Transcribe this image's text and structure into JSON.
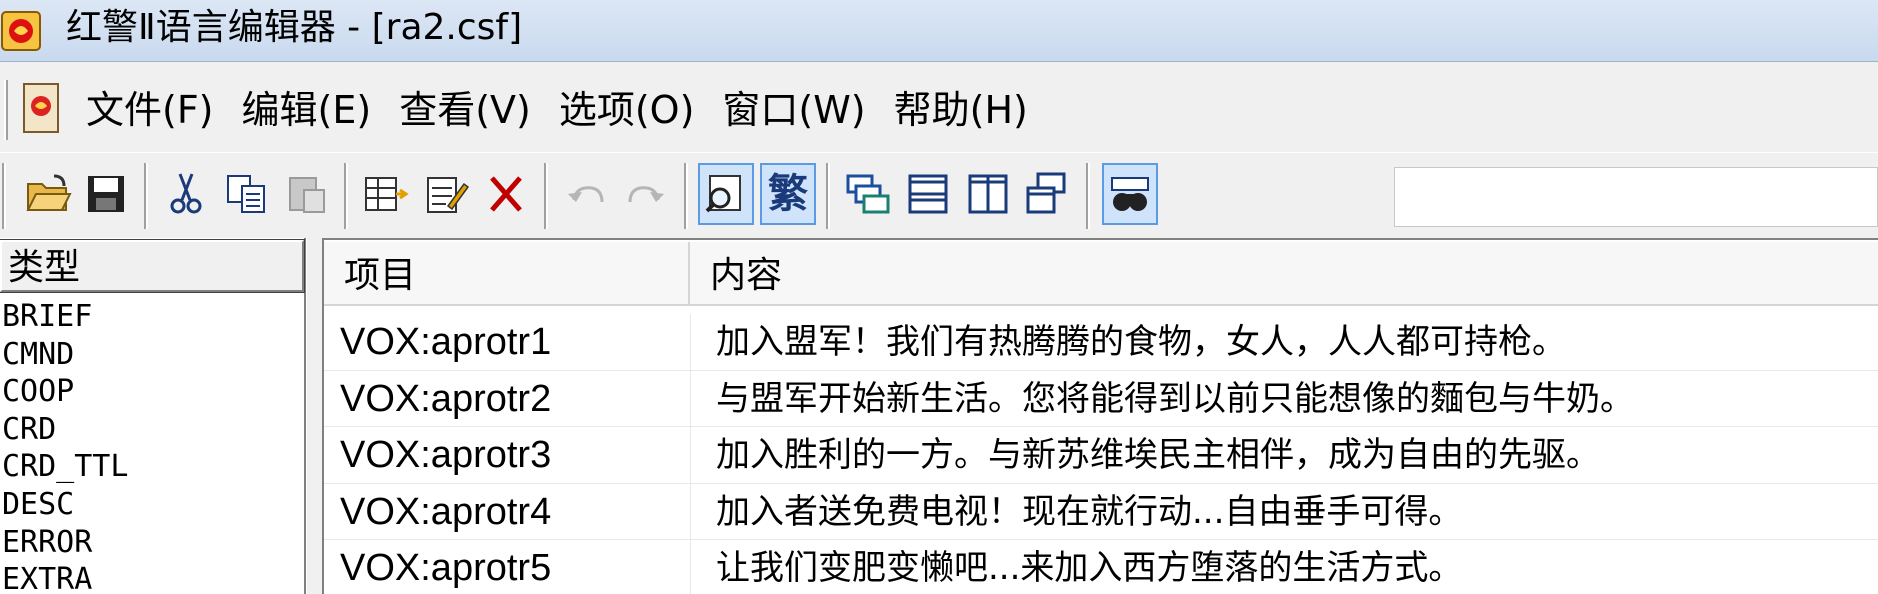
{
  "window": {
    "title": "红警Ⅱ语言编辑器 - [ra2.csf]",
    "app_icon": "red-alert-app-icon"
  },
  "menu": {
    "doc_icon": "document-icon",
    "items": [
      "文件(F)",
      "编辑(E)",
      "查看(V)",
      "选项(O)",
      "窗口(W)",
      "帮助(H)"
    ]
  },
  "toolbar": {
    "buttons": [
      {
        "name": "open-folder-icon",
        "enabled": true
      },
      {
        "name": "save-icon",
        "enabled": true
      },
      {
        "name": "cut-icon",
        "enabled": true
      },
      {
        "name": "copy-icon",
        "enabled": true
      },
      {
        "name": "paste-icon",
        "enabled": false
      },
      {
        "name": "add-entry-icon",
        "enabled": true
      },
      {
        "name": "edit-entry-icon",
        "enabled": true
      },
      {
        "name": "delete-icon",
        "enabled": true
      },
      {
        "name": "undo-icon",
        "enabled": false
      },
      {
        "name": "redo-icon",
        "enabled": false
      },
      {
        "name": "find-icon",
        "enabled": true,
        "pressed": true
      },
      {
        "name": "traditional-chinese-toggle",
        "label": "繁",
        "pressed": true
      },
      {
        "name": "cascade-windows-icon",
        "enabled": true
      },
      {
        "name": "tile-horizontal-icon",
        "enabled": true
      },
      {
        "name": "tile-vertical-icon",
        "enabled": true
      },
      {
        "name": "arrange-windows-icon",
        "enabled": true
      },
      {
        "name": "binoculars-icon",
        "enabled": true,
        "pressed": true
      }
    ],
    "search_value": ""
  },
  "left_panel": {
    "header": "类型",
    "items": [
      "BRIEF",
      "CMND",
      "COOP",
      "CRD",
      "CRD_TTL",
      "DESC",
      "ERROR",
      "EXTRA"
    ]
  },
  "table": {
    "columns": [
      "项目",
      "内容"
    ],
    "rows": [
      {
        "key": "VOX:aprotr1",
        "value": "加入盟军！我们有热腾腾的食物，女人，人人都可持枪。"
      },
      {
        "key": "VOX:aprotr2",
        "value": "与盟军开始新生活。您将能得到以前只能想像的麵包与牛奶。"
      },
      {
        "key": "VOX:aprotr3",
        "value": "加入胜利的一方。与新苏维埃民主相伴，成为自由的先驱。"
      },
      {
        "key": "VOX:aprotr4",
        "value": "加入者送免费电视！现在就行动...自由垂手可得。"
      },
      {
        "key": "VOX:aprotr5",
        "value": "让我们变肥变懒吧...来加入西方堕落的生活方式。"
      }
    ]
  },
  "colors": {
    "titlebar": "#c9d9ee",
    "chrome": "#f0f0f0",
    "pressed_bg": "#cfe3fb",
    "pressed_border": "#5a9be3",
    "delete_red": "#c00000",
    "icon_blue": "#1a4fa0"
  }
}
